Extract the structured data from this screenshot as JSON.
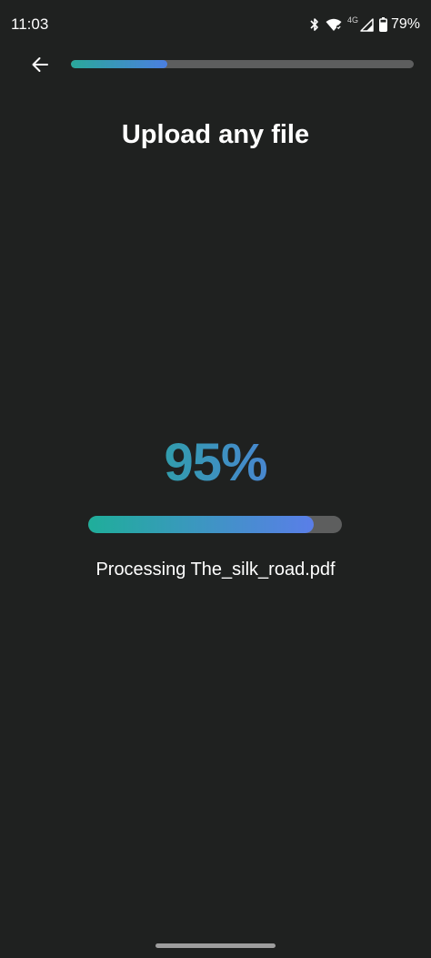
{
  "status_bar": {
    "time": "11:03",
    "network": "4G",
    "battery_percent": "79%",
    "icons": [
      "bluetooth-icon",
      "wifi-icon",
      "cell-signal-icon",
      "battery-icon"
    ]
  },
  "header": {
    "back_icon": "arrow-left-icon",
    "step_progress": 0.28
  },
  "page": {
    "title": "Upload any file"
  },
  "upload": {
    "percent_text": "95%",
    "progress": 0.89,
    "status_text": "Processing The_silk_road.pdf"
  },
  "colors": {
    "background": "#1f2120",
    "track": "#5d5e5e",
    "gradient_start": "#25a999",
    "gradient_end": "#547be3"
  }
}
